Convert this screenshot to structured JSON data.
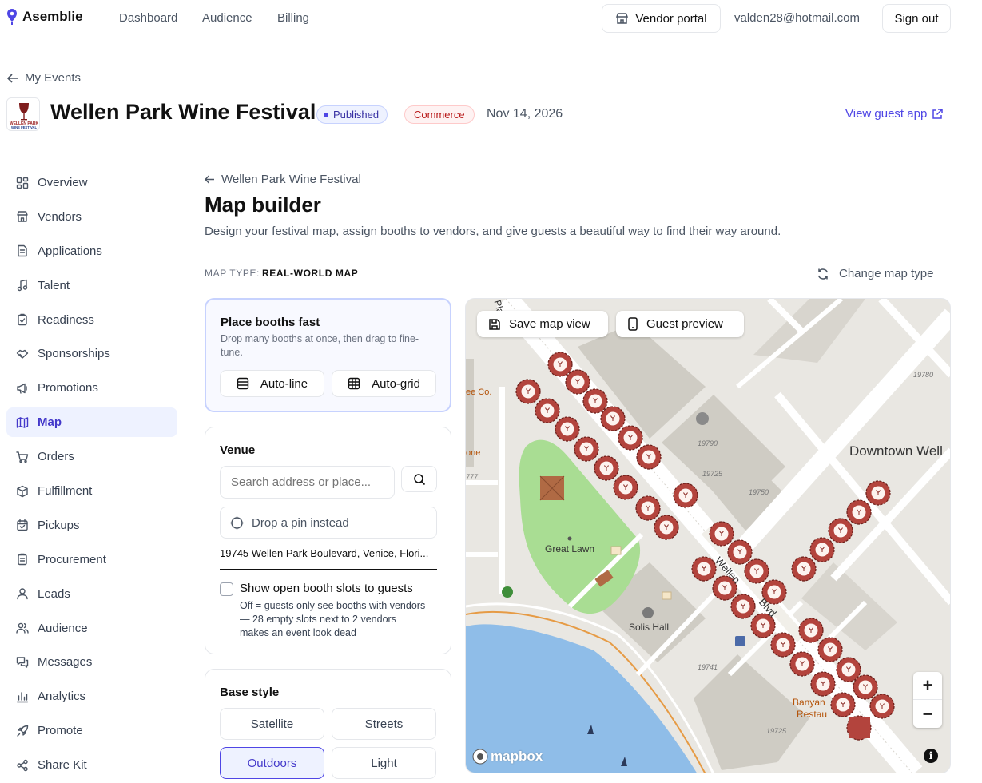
{
  "app": {
    "brand": "Asemblie",
    "nav": [
      "Dashboard",
      "Audience",
      "Billing"
    ],
    "vendor_portal": "Vendor portal",
    "user_email": "valden28@hotmail.com",
    "sign_out": "Sign out"
  },
  "event": {
    "back_label": "My Events",
    "logo_text_1": "WELLEN PARK",
    "logo_text_2": "WINE FESTIVAL",
    "title": "Wellen Park Wine Festival",
    "status": "Published",
    "category": "Commerce",
    "date": "Nov 14, 2026",
    "view_guest_app": "View guest app"
  },
  "sidebar": {
    "items": [
      {
        "label": "Overview",
        "icon": "grid-icon"
      },
      {
        "label": "Vendors",
        "icon": "store-icon"
      },
      {
        "label": "Applications",
        "icon": "file-icon"
      },
      {
        "label": "Talent",
        "icon": "music-icon"
      },
      {
        "label": "Readiness",
        "icon": "clipboard-check-icon"
      },
      {
        "label": "Sponsorships",
        "icon": "handshake-icon"
      },
      {
        "label": "Promotions",
        "icon": "megaphone-icon"
      },
      {
        "label": "Map",
        "icon": "map-icon",
        "active": true
      },
      {
        "label": "Orders",
        "icon": "cart-icon"
      },
      {
        "label": "Fulfillment",
        "icon": "package-icon"
      },
      {
        "label": "Pickups",
        "icon": "calendar-check-icon"
      },
      {
        "label": "Procurement",
        "icon": "clipboard-list-icon"
      },
      {
        "label": "Leads",
        "icon": "user-icon"
      },
      {
        "label": "Audience",
        "icon": "users-icon"
      },
      {
        "label": "Messages",
        "icon": "messages-icon"
      },
      {
        "label": "Analytics",
        "icon": "bar-chart-icon"
      },
      {
        "label": "Promote",
        "icon": "rocket-icon"
      },
      {
        "label": "Share Kit",
        "icon": "share-icon"
      }
    ]
  },
  "main": {
    "breadcrumb": "Wellen Park Wine Festival",
    "title": "Map builder",
    "description": "Design your festival map, assign booths to vendors, and give guests a beautiful way to find their way around.",
    "map_type_label": "MAP TYPE:",
    "map_type_value": "REAL-WORLD MAP",
    "change_map_type": "Change map type"
  },
  "place_booths": {
    "title": "Place booths fast",
    "subtitle": "Drop many booths at once, then drag to fine-tune.",
    "auto_line": "Auto-line",
    "auto_grid": "Auto-grid"
  },
  "venue": {
    "title": "Venue",
    "search_placeholder": "Search address or place...",
    "drop_pin": "Drop a pin instead",
    "address": "19745 Wellen Park Boulevard, Venice, Flori...",
    "show_open_slots": "Show open booth slots to guests",
    "show_open_slots_help": "Off = guests only see booths with vendors — 28 empty slots next to 2 vendors makes an event look dead",
    "show_open_slots_checked": false
  },
  "base_style": {
    "title": "Base style",
    "options": [
      "Satellite",
      "Streets",
      "Outdoors",
      "Light"
    ],
    "selected": "Outdoors"
  },
  "map": {
    "save_view": "Save map view",
    "guest_preview": "Guest preview",
    "zoom_in": "+",
    "zoom_out": "−",
    "attribution": "mapbox",
    "labels": {
      "downtown": "Downtown Well",
      "great_lawn": "Great Lawn",
      "solis_hall": "Solis Hall",
      "banyan_1": "Banyan",
      "banyan_2": "Restau",
      "street_fragment": "ee Co.",
      "one_fragment": "one",
      "n19780": "19780",
      "n19790": "19790",
      "n19725a": "19725",
      "n19750": "19750",
      "n19741": "19741",
      "n19725b": "19725",
      "n777": "777",
      "road_a": "Pla",
      "blvd_1": "Wellen",
      "blvd_2": "Blvd"
    },
    "colors": {
      "water": "#8fbde8",
      "park": "#a9dd93",
      "booth": "#b3443d",
      "road": "#ffffff",
      "building": "#cfccc4"
    }
  }
}
